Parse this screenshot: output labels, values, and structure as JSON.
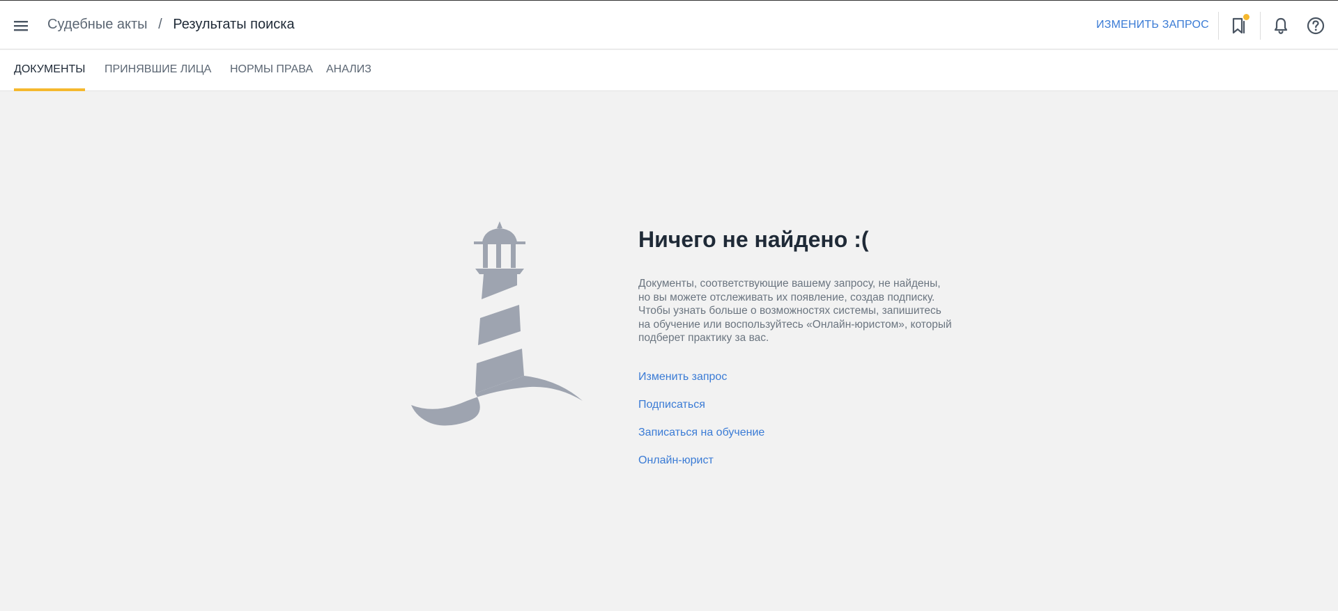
{
  "header": {
    "breadcrumb": {
      "section": "Судебные акты",
      "separator": "/",
      "current": "Результаты поиска"
    },
    "change_query_label": "ИЗМЕНИТЬ ЗАПРОС",
    "icons": [
      "menu-icon",
      "bookmarks-icon",
      "bell-icon",
      "help-icon"
    ],
    "notification_dot_color": "#f5b82e"
  },
  "tabs": [
    {
      "label": "ДОКУМЕНТЫ",
      "active": true
    },
    {
      "label": "ПРИНЯВШИЕ ЛИЦА",
      "active": false
    },
    {
      "label": "НОРМЫ ПРАВА",
      "active": false
    },
    {
      "label": "АНАЛИЗ",
      "active": false
    }
  ],
  "empty_state": {
    "illustration": "lighthouse-illustration",
    "title": "Ничего не найдено :(",
    "description_lines": [
      "Документы, соответствующие вашему запросу, не найдены,",
      "но вы можете отслеживать их появление, создав подписку.",
      "Чтобы узнать больше о возможностях системы, запишитесь",
      "на обучение или воспользуйтесь «Онлайн-юристом», который",
      "подберет практику за вас."
    ],
    "links": [
      "Изменить запрос",
      "Подписаться",
      "Записаться на обучение",
      "Онлайн-юрист"
    ]
  },
  "colors": {
    "accent": "#f5b82e",
    "link": "#3a7bd5",
    "illustration": "#9ea4b0",
    "background": "#f2f2f2"
  }
}
